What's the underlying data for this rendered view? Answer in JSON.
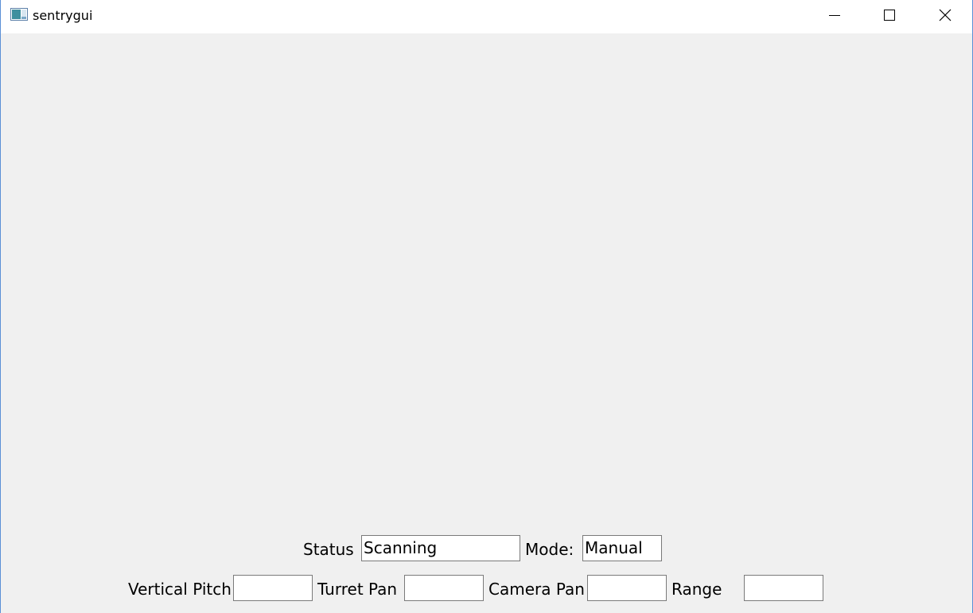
{
  "window": {
    "title": "sentrygui",
    "icon": "app-window-icon",
    "controls": [
      "minimize-icon",
      "maximize-icon",
      "close-icon"
    ]
  },
  "row1": {
    "status_label": "Status",
    "status_value": "Scanning",
    "mode_label": "Mode:",
    "mode_value": "Manual"
  },
  "row2": {
    "vertical_pitch_label": "Vertical Pitch",
    "vertical_pitch_value": "",
    "turret_pan_label": "Turret Pan",
    "turret_pan_value": "",
    "camera_pan_label": "Camera Pan",
    "camera_pan_value": "",
    "range_label": "Range",
    "range_value": ""
  },
  "colors": {
    "client_background": "#f0f0f0",
    "window_border": "#5a8fd6",
    "field_border": "#7a7a7a"
  }
}
